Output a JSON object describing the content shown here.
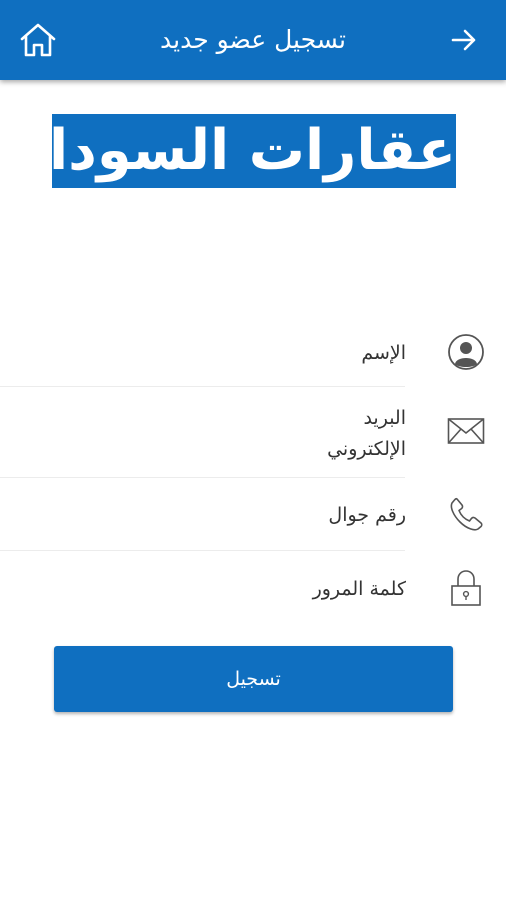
{
  "appbar": {
    "title": "تسجيل عضو جديد",
    "back_icon": "arrow-right-icon",
    "home_icon": "home-icon",
    "color": "#0f6fc0"
  },
  "logo": {
    "text": "عقارات السودان"
  },
  "form": {
    "name": {
      "placeholder": "الإسم",
      "icon": "user-icon"
    },
    "email": {
      "placeholder": "البريد\nالإلكتروني",
      "icon": "envelope-icon"
    },
    "phone": {
      "placeholder": "رقم جوال",
      "icon": "phone-icon"
    },
    "password": {
      "placeholder": "كلمة المرور",
      "icon": "lock-icon"
    }
  },
  "submit": {
    "label": "تسجيل"
  }
}
